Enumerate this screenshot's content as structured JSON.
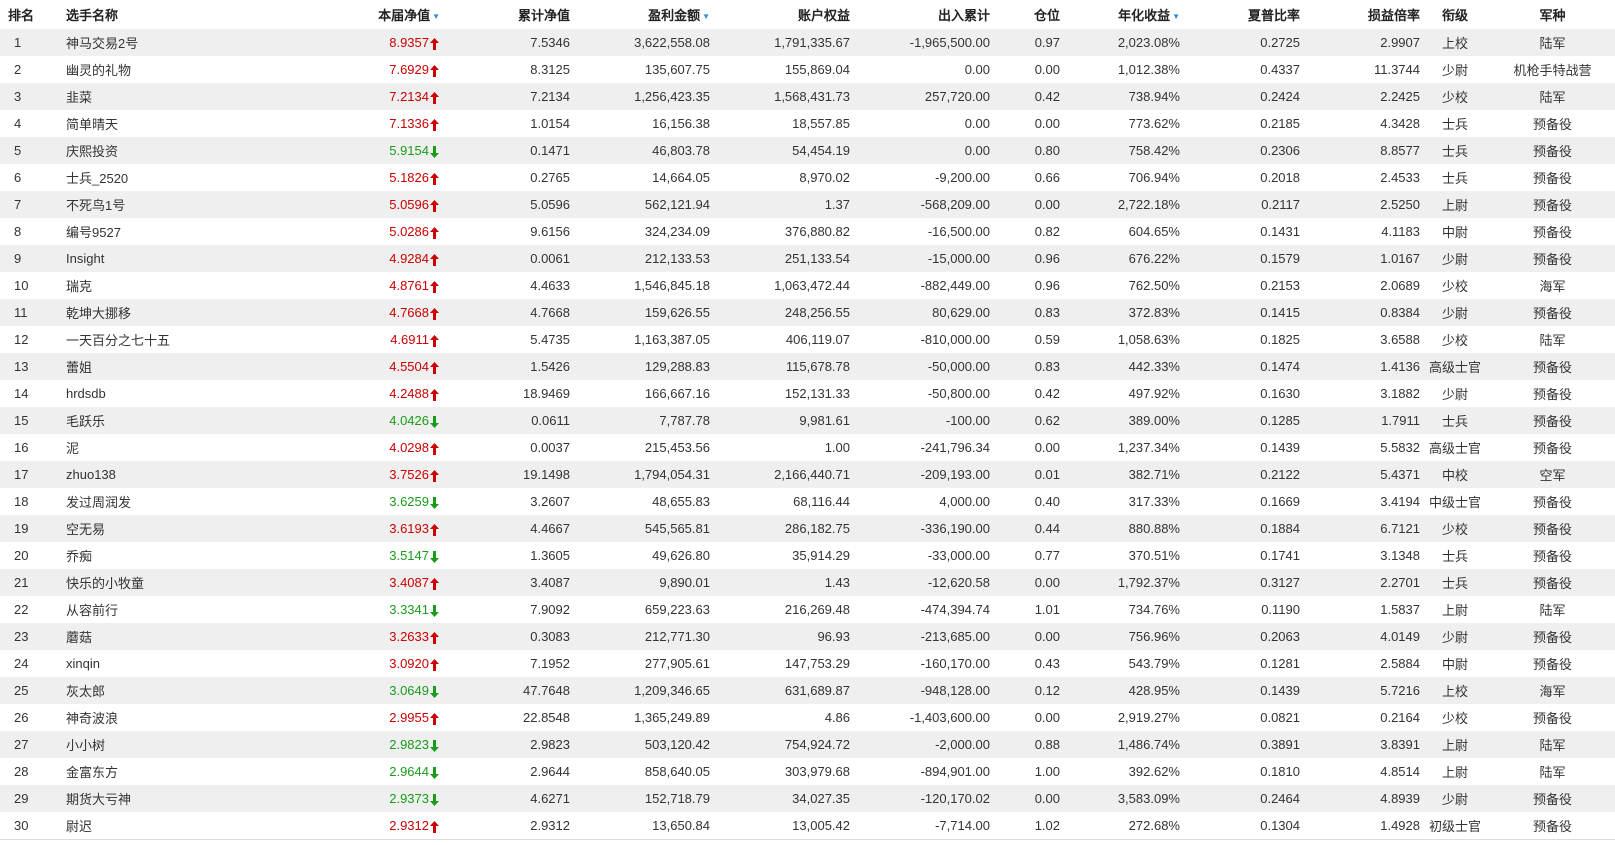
{
  "colors": {
    "up": "#cc0000",
    "down": "#1a9c1a",
    "sort": "#2a8fd6",
    "stripe": "#efefef"
  },
  "headers": {
    "rank": "排名",
    "name": "选手名称",
    "nav": "本届净值",
    "cum_nav": "累计净值",
    "profit": "盈利金额",
    "equity": "账户权益",
    "flow": "出入累计",
    "position": "仓位",
    "annual": "年化收益",
    "sharpe": "夏普比率",
    "pl_ratio": "损益倍率",
    "title": "衔级",
    "branch": "军种"
  },
  "sort_icons": {
    "nav": "down-triangle-icon",
    "profit": "down-triangle-icon",
    "annual": "down-triangle-icon"
  },
  "rows": [
    {
      "rank": "1",
      "name": "神马交易2号",
      "nav": "8.9357",
      "dir": "up",
      "cum_nav": "7.5346",
      "profit": "3,622,558.08",
      "equity": "1,791,335.67",
      "flow": "-1,965,500.00",
      "position": "0.97",
      "annual": "2,023.08%",
      "sharpe": "0.2725",
      "pl_ratio": "2.9907",
      "title": "上校",
      "branch": "陆军"
    },
    {
      "rank": "2",
      "name": "幽灵的礼物",
      "nav": "7.6929",
      "dir": "up",
      "cum_nav": "8.3125",
      "profit": "135,607.75",
      "equity": "155,869.04",
      "flow": "0.00",
      "position": "0.00",
      "annual": "1,012.38%",
      "sharpe": "0.4337",
      "pl_ratio": "11.3744",
      "title": "少尉",
      "branch": "机枪手特战营"
    },
    {
      "rank": "3",
      "name": "韭菜",
      "nav": "7.2134",
      "dir": "up",
      "cum_nav": "7.2134",
      "profit": "1,256,423.35",
      "equity": "1,568,431.73",
      "flow": "257,720.00",
      "position": "0.42",
      "annual": "738.94%",
      "sharpe": "0.2424",
      "pl_ratio": "2.2425",
      "title": "少校",
      "branch": "陆军"
    },
    {
      "rank": "4",
      "name": "简单晴天",
      "nav": "7.1336",
      "dir": "up",
      "cum_nav": "1.0154",
      "profit": "16,156.38",
      "equity": "18,557.85",
      "flow": "0.00",
      "position": "0.00",
      "annual": "773.62%",
      "sharpe": "0.2185",
      "pl_ratio": "4.3428",
      "title": "士兵",
      "branch": "预备役"
    },
    {
      "rank": "5",
      "name": "庆熙投资",
      "nav": "5.9154",
      "dir": "down",
      "cum_nav": "0.1471",
      "profit": "46,803.78",
      "equity": "54,454.19",
      "flow": "0.00",
      "position": "0.80",
      "annual": "758.42%",
      "sharpe": "0.2306",
      "pl_ratio": "8.8577",
      "title": "士兵",
      "branch": "预备役"
    },
    {
      "rank": "6",
      "name": "士兵_2520",
      "nav": "5.1826",
      "dir": "up",
      "cum_nav": "0.2765",
      "profit": "14,664.05",
      "equity": "8,970.02",
      "flow": "-9,200.00",
      "position": "0.66",
      "annual": "706.94%",
      "sharpe": "0.2018",
      "pl_ratio": "2.4533",
      "title": "士兵",
      "branch": "预备役"
    },
    {
      "rank": "7",
      "name": "不死鸟1号",
      "nav": "5.0596",
      "dir": "up",
      "cum_nav": "5.0596",
      "profit": "562,121.94",
      "equity": "1.37",
      "flow": "-568,209.00",
      "position": "0.00",
      "annual": "2,722.18%",
      "sharpe": "0.2117",
      "pl_ratio": "2.5250",
      "title": "上尉",
      "branch": "预备役"
    },
    {
      "rank": "8",
      "name": "编号9527",
      "nav": "5.0286",
      "dir": "up",
      "cum_nav": "9.6156",
      "profit": "324,234.09",
      "equity": "376,880.82",
      "flow": "-16,500.00",
      "position": "0.82",
      "annual": "604.65%",
      "sharpe": "0.1431",
      "pl_ratio": "4.1183",
      "title": "中尉",
      "branch": "预备役"
    },
    {
      "rank": "9",
      "name": "Insight",
      "nav": "4.9284",
      "dir": "up",
      "cum_nav": "0.0061",
      "profit": "212,133.53",
      "equity": "251,133.54",
      "flow": "-15,000.00",
      "position": "0.96",
      "annual": "676.22%",
      "sharpe": "0.1579",
      "pl_ratio": "1.0167",
      "title": "少尉",
      "branch": "预备役"
    },
    {
      "rank": "10",
      "name": "瑞克",
      "nav": "4.8761",
      "dir": "up",
      "cum_nav": "4.4633",
      "profit": "1,546,845.18",
      "equity": "1,063,472.44",
      "flow": "-882,449.00",
      "position": "0.96",
      "annual": "762.50%",
      "sharpe": "0.2153",
      "pl_ratio": "2.0689",
      "title": "少校",
      "branch": "海军"
    },
    {
      "rank": "11",
      "name": "乾坤大挪移",
      "nav": "4.7668",
      "dir": "up",
      "cum_nav": "4.7668",
      "profit": "159,626.55",
      "equity": "248,256.55",
      "flow": "80,629.00",
      "position": "0.83",
      "annual": "372.83%",
      "sharpe": "0.1415",
      "pl_ratio": "0.8384",
      "title": "少尉",
      "branch": "预备役"
    },
    {
      "rank": "12",
      "name": "一天百分之七十五",
      "nav": "4.6911",
      "dir": "up",
      "cum_nav": "5.4735",
      "profit": "1,163,387.05",
      "equity": "406,119.07",
      "flow": "-810,000.00",
      "position": "0.59",
      "annual": "1,058.63%",
      "sharpe": "0.1825",
      "pl_ratio": "3.6588",
      "title": "少校",
      "branch": "陆军"
    },
    {
      "rank": "13",
      "name": "蕾姐",
      "nav": "4.5504",
      "dir": "up",
      "cum_nav": "1.5426",
      "profit": "129,288.83",
      "equity": "115,678.78",
      "flow": "-50,000.00",
      "position": "0.83",
      "annual": "442.33%",
      "sharpe": "0.1474",
      "pl_ratio": "1.4136",
      "title": "高级士官",
      "branch": "预备役"
    },
    {
      "rank": "14",
      "name": "hrdsdb",
      "nav": "4.2488",
      "dir": "up",
      "cum_nav": "18.9469",
      "profit": "166,667.16",
      "equity": "152,131.33",
      "flow": "-50,800.00",
      "position": "0.42",
      "annual": "497.92%",
      "sharpe": "0.1630",
      "pl_ratio": "3.1882",
      "title": "少尉",
      "branch": "预备役"
    },
    {
      "rank": "15",
      "name": "毛跃乐",
      "nav": "4.0426",
      "dir": "down",
      "cum_nav": "0.0611",
      "profit": "7,787.78",
      "equity": "9,981.61",
      "flow": "-100.00",
      "position": "0.62",
      "annual": "389.00%",
      "sharpe": "0.1285",
      "pl_ratio": "1.7911",
      "title": "士兵",
      "branch": "预备役"
    },
    {
      "rank": "16",
      "name": "泥",
      "nav": "4.0298",
      "dir": "up",
      "cum_nav": "0.0037",
      "profit": "215,453.56",
      "equity": "1.00",
      "flow": "-241,796.34",
      "position": "0.00",
      "annual": "1,237.34%",
      "sharpe": "0.1439",
      "pl_ratio": "5.5832",
      "title": "高级士官",
      "branch": "预备役"
    },
    {
      "rank": "17",
      "name": "zhuo138",
      "nav": "3.7526",
      "dir": "up",
      "cum_nav": "19.1498",
      "profit": "1,794,054.31",
      "equity": "2,166,440.71",
      "flow": "-209,193.00",
      "position": "0.01",
      "annual": "382.71%",
      "sharpe": "0.2122",
      "pl_ratio": "5.4371",
      "title": "中校",
      "branch": "空军"
    },
    {
      "rank": "18",
      "name": "发过周润发",
      "nav": "3.6259",
      "dir": "down",
      "cum_nav": "3.2607",
      "profit": "48,655.83",
      "equity": "68,116.44",
      "flow": "4,000.00",
      "position": "0.40",
      "annual": "317.33%",
      "sharpe": "0.1669",
      "pl_ratio": "3.4194",
      "title": "中级士官",
      "branch": "预备役"
    },
    {
      "rank": "19",
      "name": "空无易",
      "nav": "3.6193",
      "dir": "up",
      "cum_nav": "4.4667",
      "profit": "545,565.81",
      "equity": "286,182.75",
      "flow": "-336,190.00",
      "position": "0.44",
      "annual": "880.88%",
      "sharpe": "0.1884",
      "pl_ratio": "6.7121",
      "title": "少校",
      "branch": "预备役"
    },
    {
      "rank": "20",
      "name": "乔痴",
      "nav": "3.5147",
      "dir": "down",
      "cum_nav": "1.3605",
      "profit": "49,626.80",
      "equity": "35,914.29",
      "flow": "-33,000.00",
      "position": "0.77",
      "annual": "370.51%",
      "sharpe": "0.1741",
      "pl_ratio": "3.1348",
      "title": "士兵",
      "branch": "预备役"
    },
    {
      "rank": "21",
      "name": "快乐的小牧童",
      "nav": "3.4087",
      "dir": "up",
      "cum_nav": "3.4087",
      "profit": "9,890.01",
      "equity": "1.43",
      "flow": "-12,620.58",
      "position": "0.00",
      "annual": "1,792.37%",
      "sharpe": "0.3127",
      "pl_ratio": "2.2701",
      "title": "士兵",
      "branch": "预备役"
    },
    {
      "rank": "22",
      "name": "从容前行",
      "nav": "3.3341",
      "dir": "down",
      "cum_nav": "7.9092",
      "profit": "659,223.63",
      "equity": "216,269.48",
      "flow": "-474,394.74",
      "position": "1.01",
      "annual": "734.76%",
      "sharpe": "0.1190",
      "pl_ratio": "1.5837",
      "title": "上尉",
      "branch": "陆军"
    },
    {
      "rank": "23",
      "name": "蘑菇",
      "nav": "3.2633",
      "dir": "up",
      "cum_nav": "0.3083",
      "profit": "212,771.30",
      "equity": "96.93",
      "flow": "-213,685.00",
      "position": "0.00",
      "annual": "756.96%",
      "sharpe": "0.2063",
      "pl_ratio": "4.0149",
      "title": "少尉",
      "branch": "预备役"
    },
    {
      "rank": "24",
      "name": "xinqin",
      "nav": "3.0920",
      "dir": "up",
      "cum_nav": "7.1952",
      "profit": "277,905.61",
      "equity": "147,753.29",
      "flow": "-160,170.00",
      "position": "0.43",
      "annual": "543.79%",
      "sharpe": "0.1281",
      "pl_ratio": "2.5884",
      "title": "中尉",
      "branch": "预备役"
    },
    {
      "rank": "25",
      "name": "灰太郎",
      "nav": "3.0649",
      "dir": "down",
      "cum_nav": "47.7648",
      "profit": "1,209,346.65",
      "equity": "631,689.87",
      "flow": "-948,128.00",
      "position": "0.12",
      "annual": "428.95%",
      "sharpe": "0.1439",
      "pl_ratio": "5.7216",
      "title": "上校",
      "branch": "海军"
    },
    {
      "rank": "26",
      "name": "神奇波浪",
      "nav": "2.9955",
      "dir": "up",
      "cum_nav": "22.8548",
      "profit": "1,365,249.89",
      "equity": "4.86",
      "flow": "-1,403,600.00",
      "position": "0.00",
      "annual": "2,919.27%",
      "sharpe": "0.0821",
      "pl_ratio": "0.2164",
      "title": "少校",
      "branch": "预备役"
    },
    {
      "rank": "27",
      "name": "小小树",
      "nav": "2.9823",
      "dir": "down",
      "cum_nav": "2.9823",
      "profit": "503,120.42",
      "equity": "754,924.72",
      "flow": "-2,000.00",
      "position": "0.88",
      "annual": "1,486.74%",
      "sharpe": "0.3891",
      "pl_ratio": "3.8391",
      "title": "上尉",
      "branch": "陆军"
    },
    {
      "rank": "28",
      "name": "金富东方",
      "nav": "2.9644",
      "dir": "down",
      "cum_nav": "2.9644",
      "profit": "858,640.05",
      "equity": "303,979.68",
      "flow": "-894,901.00",
      "position": "1.00",
      "annual": "392.62%",
      "sharpe": "0.1810",
      "pl_ratio": "4.8514",
      "title": "上尉",
      "branch": "陆军"
    },
    {
      "rank": "29",
      "name": "期货大亏神",
      "nav": "2.9373",
      "dir": "down",
      "cum_nav": "4.6271",
      "profit": "152,718.79",
      "equity": "34,027.35",
      "flow": "-120,170.02",
      "position": "0.00",
      "annual": "3,583.09%",
      "sharpe": "0.2464",
      "pl_ratio": "4.8939",
      "title": "少尉",
      "branch": "预备役"
    },
    {
      "rank": "30",
      "name": "尉迟",
      "nav": "2.9312",
      "dir": "up",
      "cum_nav": "2.9312",
      "profit": "13,650.84",
      "equity": "13,005.42",
      "flow": "-7,714.00",
      "position": "1.02",
      "annual": "272.68%",
      "sharpe": "0.1304",
      "pl_ratio": "1.4928",
      "title": "初级士官",
      "branch": "预备役"
    }
  ]
}
